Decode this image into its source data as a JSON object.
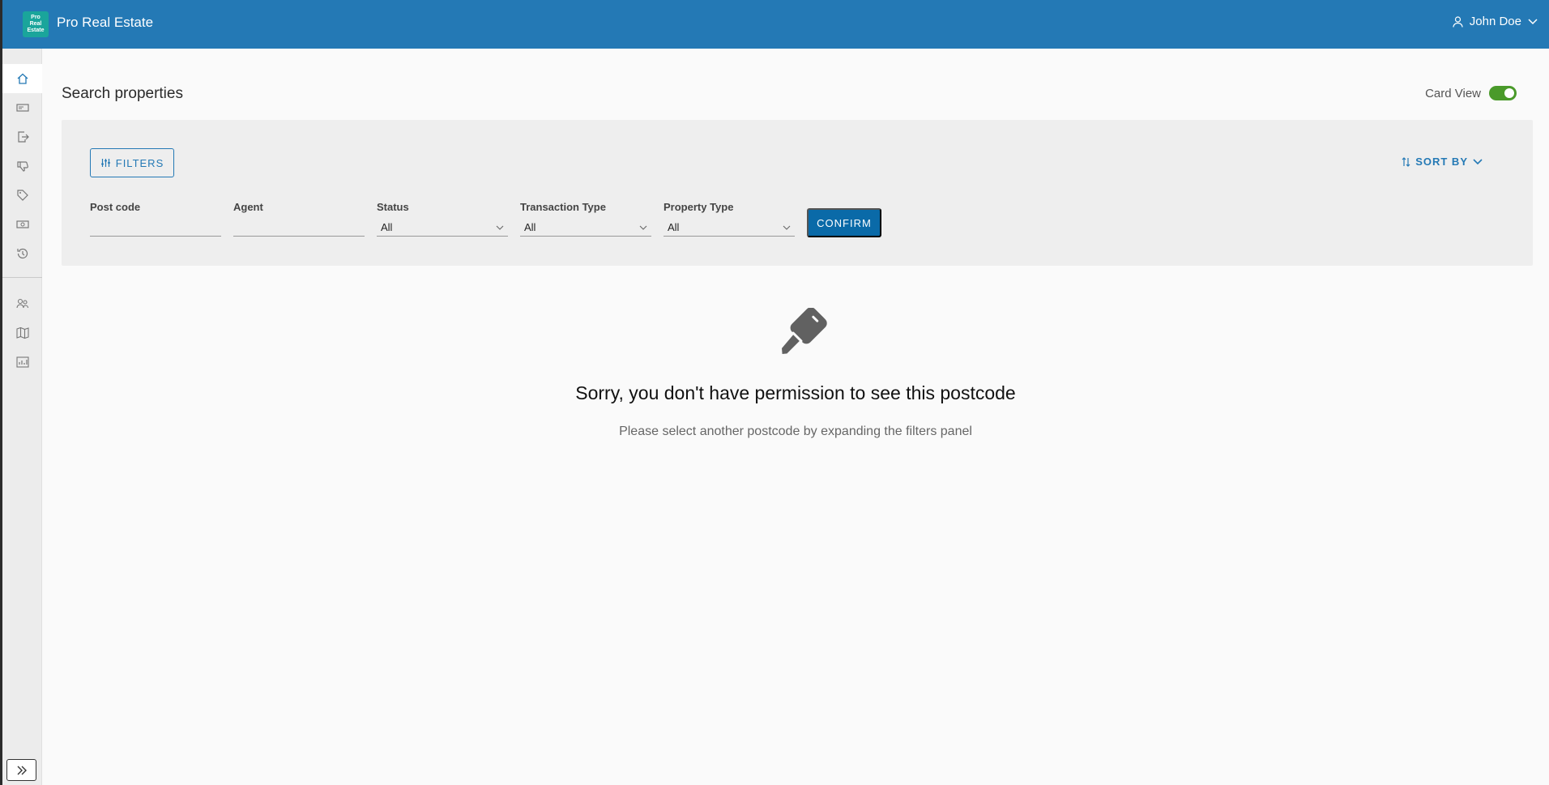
{
  "app": {
    "logo_lines": [
      "Pro",
      "Real",
      "Estate"
    ],
    "title": "Pro Real Estate",
    "user": "John Doe"
  },
  "sidebar": {
    "items": [
      {
        "icon": "home-icon"
      },
      {
        "icon": "card-icon"
      },
      {
        "icon": "export-icon"
      },
      {
        "icon": "thumbs-down-icon"
      },
      {
        "icon": "tag-icon"
      },
      {
        "icon": "money-icon"
      },
      {
        "icon": "history-icon"
      },
      {
        "icon": "people-icon"
      },
      {
        "icon": "map-icon"
      },
      {
        "icon": "chart-icon"
      }
    ]
  },
  "page": {
    "title": "Search properties",
    "card_view_label": "Card View",
    "card_view_on": true
  },
  "filters": {
    "filters_button": "FILTERS",
    "sort_by": "SORT BY",
    "fields": [
      {
        "label": "Post code",
        "value": ""
      },
      {
        "label": "Agent",
        "value": ""
      },
      {
        "label": "Status",
        "value": "All"
      },
      {
        "label": "Transaction Type",
        "value": "All"
      },
      {
        "label": "Property Type",
        "value": "All"
      }
    ],
    "confirm": "CONFIRM"
  },
  "empty_state": {
    "title": "Sorry, you don't have permission to see this postcode",
    "subtitle": "Please select another postcode by expanding the filters panel"
  },
  "colors": {
    "header": "#2479b5",
    "logo": "#1aa59b",
    "accent": "#0a6aa8",
    "toggle": "#4a9a2a"
  }
}
